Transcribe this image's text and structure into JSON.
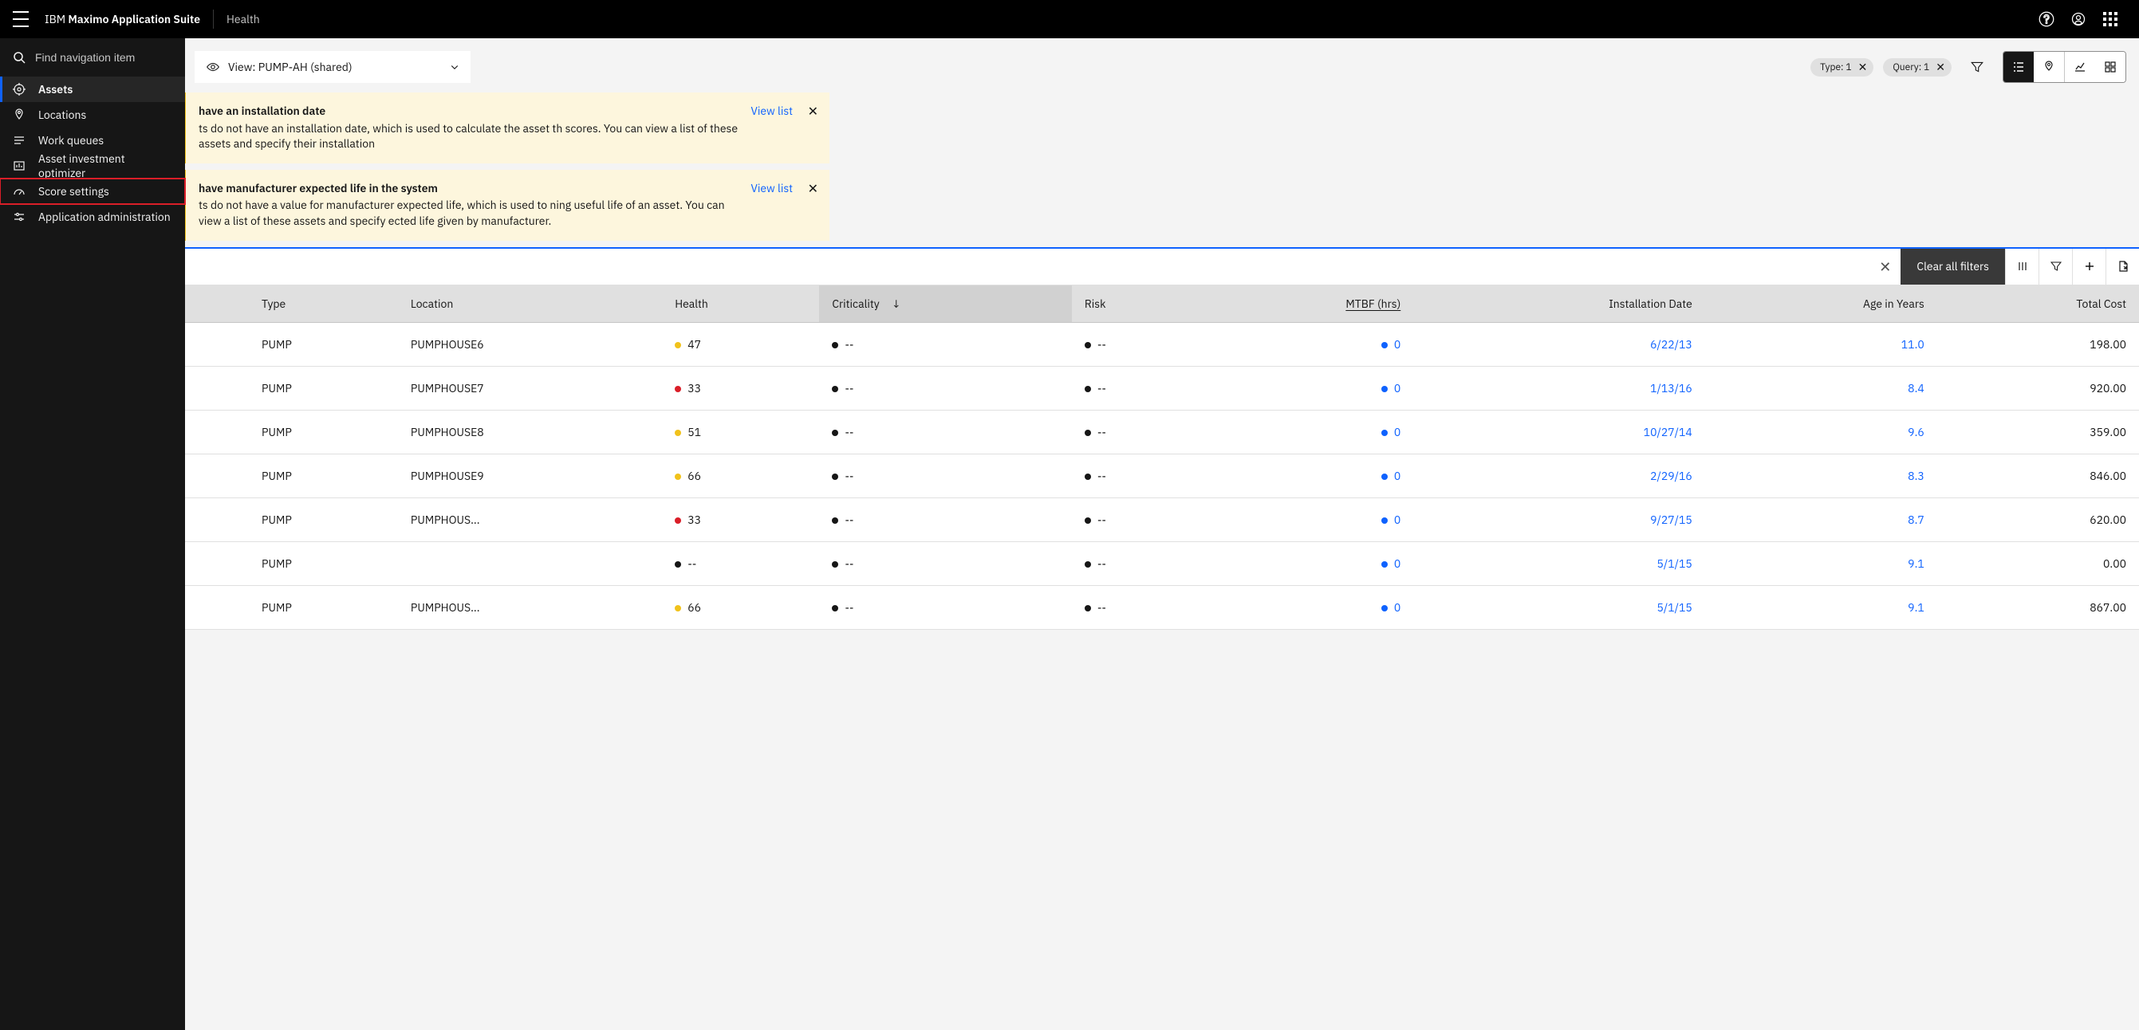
{
  "header": {
    "brand_prefix": "IBM ",
    "brand_main": "Maximo Application Suite",
    "context": "Health"
  },
  "sidebar": {
    "search_placeholder": "Find navigation item",
    "items": [
      {
        "label": "Assets"
      },
      {
        "label": "Locations"
      },
      {
        "label": "Work queues"
      },
      {
        "label": "Asset investment optimizer"
      },
      {
        "label": "Score settings"
      },
      {
        "label": "Application administration"
      }
    ]
  },
  "toolbar": {
    "view_label": "View: PUMP-AH (shared)",
    "chips": [
      {
        "label": "Type: 1"
      },
      {
        "label": "Query: 1"
      }
    ]
  },
  "notifications": [
    {
      "title": "have an installation date",
      "body": "ts do not have an installation date, which is used to calculate the asset th scores. You can view a list of these assets and specify their installation",
      "link": "View list"
    },
    {
      "title": "have manufacturer expected life in the system",
      "body": "ts do not have a value for manufacturer expected life, which is used to ning useful life of an asset. You can view a list of these assets and specify ected life given by manufacturer.",
      "link": "View list"
    }
  ],
  "filter_bar": {
    "clear_label": "Clear all filters"
  },
  "table": {
    "columns": [
      {
        "label": "Type"
      },
      {
        "label": "Location"
      },
      {
        "label": "Health"
      },
      {
        "label": "Criticality"
      },
      {
        "label": "Risk"
      },
      {
        "label": "MTBF (hrs)"
      },
      {
        "label": "Installation Date"
      },
      {
        "label": "Age in Years"
      },
      {
        "label": "Total Cost"
      }
    ],
    "rows": [
      {
        "type": "PUMP",
        "location": "PUMPHOUSE6",
        "health": "47",
        "health_dot": "yellow",
        "crit": "--",
        "risk": "--",
        "mtbf": "0",
        "install": "6/22/13",
        "age": "11.0",
        "cost": "198.00"
      },
      {
        "type": "PUMP",
        "location": "PUMPHOUSE7",
        "health": "33",
        "health_dot": "red",
        "crit": "--",
        "risk": "--",
        "mtbf": "0",
        "install": "1/13/16",
        "age": "8.4",
        "cost": "920.00"
      },
      {
        "type": "PUMP",
        "location": "PUMPHOUSE8",
        "health": "51",
        "health_dot": "yellow",
        "crit": "--",
        "risk": "--",
        "mtbf": "0",
        "install": "10/27/14",
        "age": "9.6",
        "cost": "359.00"
      },
      {
        "type": "PUMP",
        "location": "PUMPHOUSE9",
        "health": "66",
        "health_dot": "yellow",
        "crit": "--",
        "risk": "--",
        "mtbf": "0",
        "install": "2/29/16",
        "age": "8.3",
        "cost": "846.00"
      },
      {
        "type": "PUMP",
        "location": "PUMPHOUS...",
        "health": "33",
        "health_dot": "red",
        "crit": "--",
        "risk": "--",
        "mtbf": "0",
        "install": "9/27/15",
        "age": "8.7",
        "cost": "620.00"
      },
      {
        "type": "PUMP",
        "location": "",
        "health": "--",
        "health_dot": "black",
        "crit": "--",
        "risk": "--",
        "mtbf": "0",
        "install": "5/1/15",
        "age": "9.1",
        "cost": "0.00"
      },
      {
        "type": "PUMP",
        "location": "PUMPHOUS...",
        "health": "66",
        "health_dot": "yellow",
        "crit": "--",
        "risk": "--",
        "mtbf": "0",
        "install": "5/1/15",
        "age": "9.1",
        "cost": "867.00"
      }
    ]
  }
}
